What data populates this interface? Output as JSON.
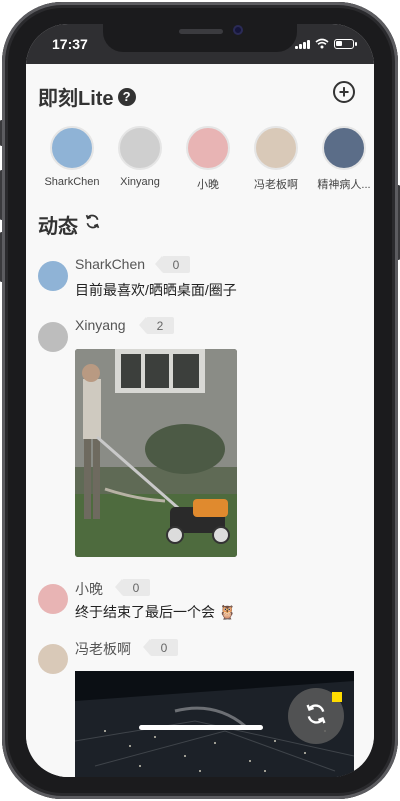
{
  "status": {
    "time": "17:37",
    "signal_icon": "signal-bars-icon",
    "wifi_icon": "wifi-icon",
    "battery_icon": "battery-icon",
    "battery_level": 0.4
  },
  "header": {
    "title": "即刻Lite",
    "help_symbol": "?",
    "help_icon": "question-circle-icon",
    "add_symbol": "+",
    "add_icon": "plus-circle-icon"
  },
  "contacts": [
    {
      "name": "SharkChen",
      "avatar_color": "#8fb3d6"
    },
    {
      "name": "Xinyang",
      "avatar_color": "#cfcfcf"
    },
    {
      "name": "小晚",
      "avatar_color": "#e8b4b4"
    },
    {
      "name": "冯老板啊",
      "avatar_color": "#d9c9b8"
    },
    {
      "name": "精神病人...",
      "avatar_color": "#5b6d88"
    }
  ],
  "feed_section": {
    "title": "动态",
    "refresh_icon": "refresh-icon"
  },
  "feed": [
    {
      "name": "SharkChen",
      "count": "0",
      "text": "目前最喜欢/晒晒桌面/圈子"
    },
    {
      "name": "Xinyang",
      "count": "2",
      "text": ""
    },
    {
      "name": "小晚",
      "count": "0",
      "text": "终于结束了最后一个会 🦉"
    },
    {
      "name": "冯老板啊",
      "count": "0",
      "text": ""
    }
  ],
  "colors": {
    "accent": "#ffdc00",
    "text": "#333333"
  },
  "fab": {
    "icon": "refresh-icon"
  }
}
